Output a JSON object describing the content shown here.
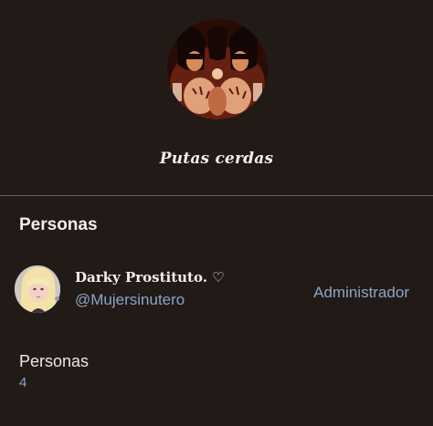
{
  "group": {
    "name": "Putas cerdas"
  },
  "members_section": {
    "heading": "Personas"
  },
  "members": [
    {
      "display_name": "Darky Prostituto. ♡",
      "handle": "@Mujersinutero",
      "role": "Administrador"
    }
  ],
  "stats": {
    "label": "Personas",
    "value": "4"
  },
  "icons": {
    "group_avatar": "group-photo",
    "member_avatar": "user-photo",
    "presence": "online-dot"
  },
  "colors": {
    "background": "#221a17",
    "divider": "#6d625c",
    "primary_text": "#f3eeea",
    "link_text": "#8aa6c4"
  }
}
